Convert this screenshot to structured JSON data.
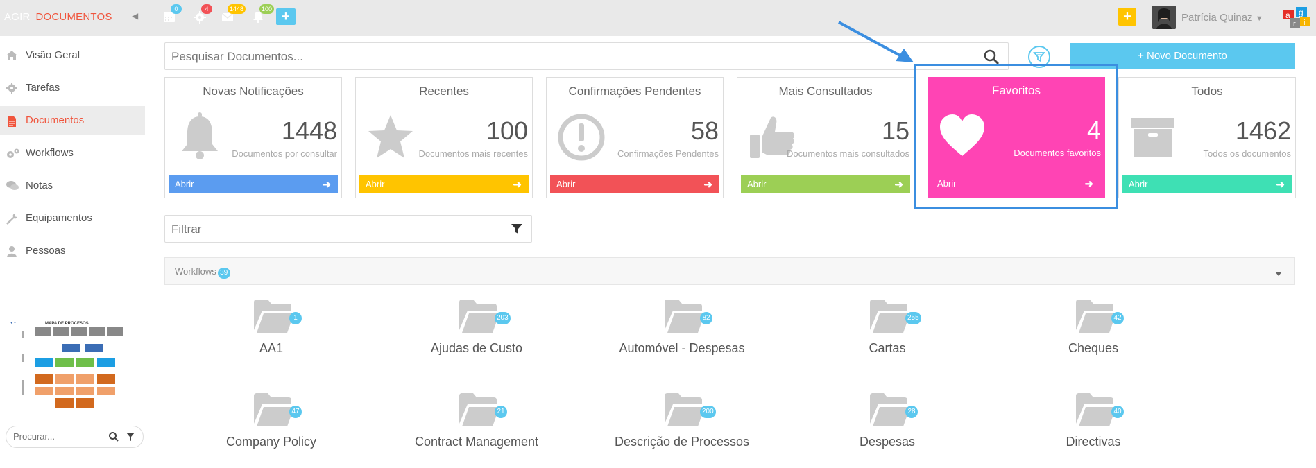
{
  "header": {
    "brand": "AGIR",
    "module": "DOCUMENTOS",
    "calendar_count": "0",
    "settings_count": "4",
    "messages_count": "1448",
    "notifications_count": "100",
    "user_name": "Patrícia Quinaz",
    "accent": "#f0553d"
  },
  "sidebar": {
    "items": [
      {
        "label": "Visão Geral",
        "icon": "home-icon"
      },
      {
        "label": "Tarefas",
        "icon": "gear-icon"
      },
      {
        "label": "Documentos",
        "icon": "document-icon"
      },
      {
        "label": "Workflows",
        "icon": "gears-icon"
      },
      {
        "label": "Notas",
        "icon": "comments-icon"
      },
      {
        "label": "Equipamentos",
        "icon": "wrench-icon"
      },
      {
        "label": "Pessoas",
        "icon": "user-icon"
      }
    ],
    "thumbnail_title": "MAPA DE PROCESOS",
    "search_placeholder": "Procurar..."
  },
  "search": {
    "placeholder": "Pesquisar Documentos...",
    "new_document": "+ Novo Documento"
  },
  "cards": [
    {
      "title": "Novas Notificações",
      "value": "1448",
      "subtitle": "Documentos por consultar",
      "button": "Abrir",
      "color": "#5b9cf0",
      "icon": "bell-icon"
    },
    {
      "title": "Recentes",
      "value": "100",
      "subtitle": "Documentos mais recentes",
      "button": "Abrir",
      "color": "#ffc400",
      "icon": "star-icon"
    },
    {
      "title": "Confirmações Pendentes",
      "value": "58",
      "subtitle": "Confirmações Pendentes",
      "button": "Abrir",
      "color": "#f25257",
      "icon": "exclamation-icon"
    },
    {
      "title": "Mais Consultados",
      "value": "15",
      "subtitle": "Documentos mais consultados",
      "button": "Abrir",
      "color": "#9ccf55",
      "icon": "thumbs-up-icon"
    },
    {
      "title": "Favoritos",
      "value": "4",
      "subtitle": "Documentos favoritos",
      "button": "Abrir",
      "color": "#ff44b4",
      "icon": "heart-icon"
    },
    {
      "title": "Todos",
      "value": "1462",
      "subtitle": "Todos os documentos",
      "button": "Abrir",
      "color": "#3ee0b4",
      "icon": "archive-icon"
    }
  ],
  "filter": {
    "placeholder": "Filtrar"
  },
  "workflows": {
    "label": "Workflows",
    "count": "39",
    "folders": [
      {
        "name": "AA1",
        "count": "1"
      },
      {
        "name": "Ajudas de Custo",
        "count": "203"
      },
      {
        "name": "Automóvel - Despesas",
        "count": "82"
      },
      {
        "name": "Cartas",
        "count": "255"
      },
      {
        "name": "Cheques",
        "count": "42"
      },
      {
        "name": "Company Policy",
        "count": "47"
      },
      {
        "name": "Contract Management",
        "count": "21"
      },
      {
        "name": "Descrição de Processos",
        "count": "200"
      },
      {
        "name": "Despesas",
        "count": "28"
      },
      {
        "name": "Directivas",
        "count": "40"
      }
    ]
  }
}
